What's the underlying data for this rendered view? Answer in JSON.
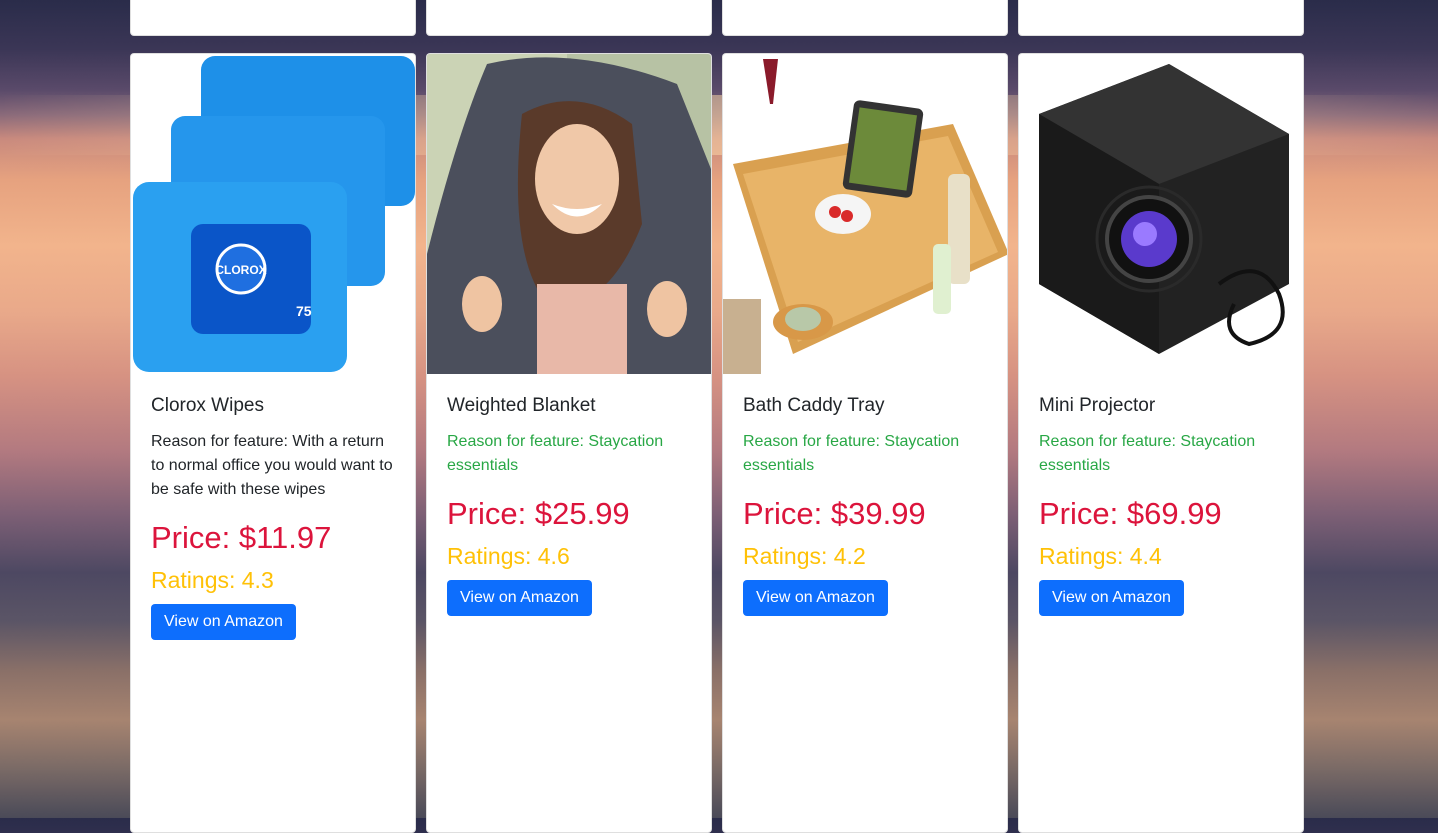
{
  "products": [
    {
      "title": "Clorox Wipes",
      "reason": "Reason for feature: With a return to normal office you would want to be safe with these wipes",
      "price": "Price: $11.97",
      "rating": "Ratings: 4.3",
      "button": "View on Amazon"
    },
    {
      "title": "Weighted Blanket",
      "reason": "Reason for feature: Staycation essentials",
      "price": "Price: $25.99",
      "rating": "Ratings: 4.6",
      "button": "View on Amazon"
    },
    {
      "title": "Bath Caddy Tray",
      "reason": "Reason for feature: Staycation essentials",
      "price": "Price: $39.99",
      "rating": "Ratings: 4.2",
      "button": "View on Amazon"
    },
    {
      "title": "Mini Projector",
      "reason": "Reason for feature: Staycation essentials",
      "price": "Price: $69.99",
      "rating": "Ratings: 4.4",
      "button": "View on Amazon"
    }
  ],
  "product_images": [
    {
      "icon": "wipes-pack-image"
    },
    {
      "icon": "woman-blanket-image"
    },
    {
      "icon": "bath-caddy-image"
    },
    {
      "icon": "projector-image"
    }
  ],
  "image_labels": {
    "wipes_brand": "CLOROX",
    "wipes_count": "75"
  },
  "colors": {
    "price": "#dc143c",
    "rating": "#ffc107",
    "reason_green": "#28a745",
    "button": "#0d6efd"
  }
}
